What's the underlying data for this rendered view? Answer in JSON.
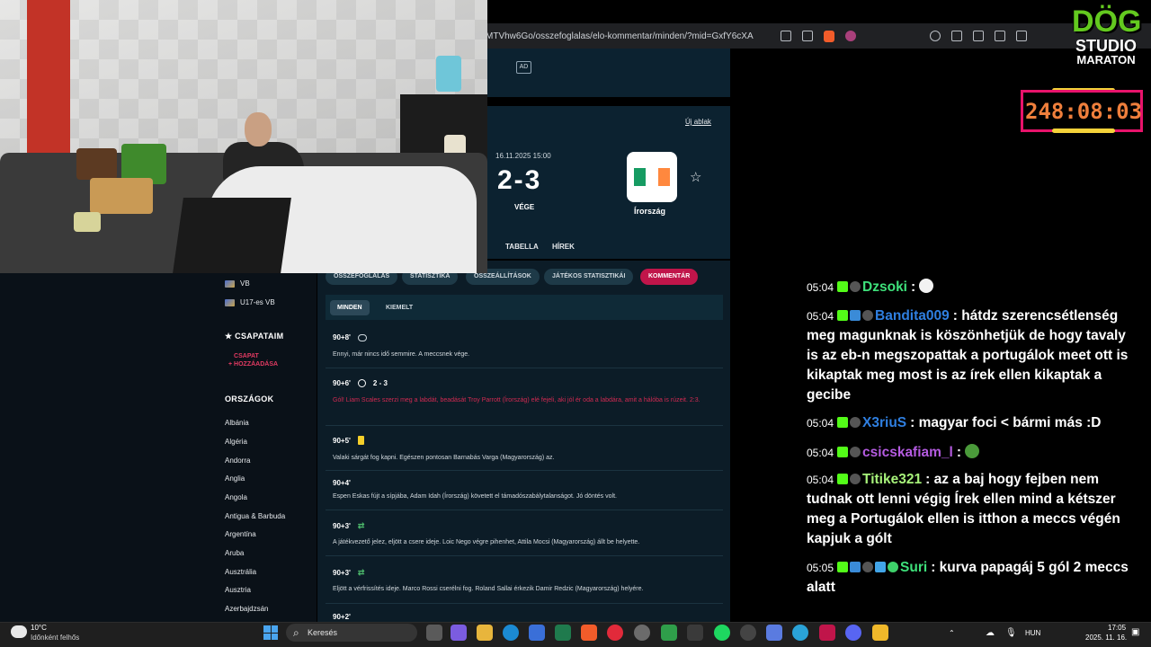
{
  "browser": {
    "url": "MTVhw6Go/osszefoglalas/elo-kommentar/minden/?mid=GxfY6cXA"
  },
  "match": {
    "ad_label": "AD",
    "new_window": "Új ablak",
    "date": "16.11.2025 15:00",
    "score": "2-3",
    "status": "VÉGE",
    "away_team": "Írország",
    "tabs": [
      "I",
      "TABELLA",
      "HÍREK"
    ],
    "subtabs": [
      "ÖSSZEFOGLALÁS",
      "STATISZTIKA",
      "ÖSSZEÁLLÍTÁSOK",
      "JÁTÉKOS STATISZTIKÁI",
      "KOMMENTÁR"
    ],
    "filters": [
      "MINDEN",
      "KIEMELT"
    ]
  },
  "comments": [
    {
      "minute": "90+8'",
      "icon": "whistle-icon",
      "text": "Ennyi, már nincs idő semmire. A meccsnek vége."
    },
    {
      "minute": "90+6'",
      "icon": "ball-icon",
      "score": "2 - 3",
      "text": "Gól! Liam Scales szerzi meg a labdát, beadását Troy Parrott (Írország) elé fejeli, aki jól ér oda a labdára, amit a hálóba is rúzeit. 2:3.",
      "goal": true
    },
    {
      "minute": "90+5'",
      "icon": "yellow-card-icon",
      "text": "Valaki sárgát fog kapni. Egészen pontosan Barnabás Varga (Magyarország) az."
    },
    {
      "minute": "90+4'",
      "icon": "",
      "text": "Espen Eskas fújt a sípjába, Adam Idah (Írország) követett el támadószabálytalanságot. Jó döntés volt."
    },
    {
      "minute": "90+3'",
      "icon": "substitution-icon",
      "text": "A játékvezető jelez, eljött a csere ideje. Loic Nego végre pihenhet, Attila Mocsi (Magyarország) állt be helyette."
    },
    {
      "minute": "90+3'",
      "icon": "substitution-icon",
      "text": "Eljött a vérfrissítés ideje. Marco Rossi cserélni fog. Roland Sallai érkezik Damir Redzic (Magyarország) helyére."
    },
    {
      "minute": "90+2'",
      "icon": "",
      "text": ""
    }
  ],
  "sidebar": {
    "competitions": [
      "VB",
      "U17-es VB"
    ],
    "my_teams": "CSAPATAIM",
    "add_team": "CSAPAT HOZZÁADÁSA",
    "countries_head": "ORSZÁGOK",
    "countries": [
      "Albánia",
      "Algéria",
      "Andorra",
      "Anglia",
      "Angola",
      "Antigua & Barbuda",
      "Argentína",
      "Aruba",
      "Ausztrália",
      "Ausztria",
      "Azerbajdzsán"
    ]
  },
  "stream": {
    "logo_line1": "DÖG",
    "logo_line2": "STUDIO",
    "logo_line3": "MARATON",
    "timer": "248:08:03"
  },
  "chat": [
    {
      "time": "05:04",
      "user": "Dzsoki",
      "color": "#3ee07a",
      "message": ""
    },
    {
      "time": "05:04",
      "user": "Bandita009",
      "color": "#2f7fe0",
      "message": "hátdz szerencsétlenség meg magunknak is köszönhetjük de hogy tavaly is az eb-n megszopattak a portugálok meet ott is kikaptak meg most is az írek ellen kikaptak a gecibe"
    },
    {
      "time": "05:04",
      "user": "X3riuS",
      "color": "#2f7fe0",
      "message": "magyar foci < bármi más :D"
    },
    {
      "time": "05:04",
      "user": "csicskafiam_l",
      "color": "#b45be0",
      "message": ""
    },
    {
      "time": "05:04",
      "user": "Titike321",
      "color": "#a7f27a",
      "message": "az a baj hogy fejben nem tudnak ott lenni végig Írek ellen mind a kétszer meg a Portugálok ellen is itthon a meccs végén kapjuk a gólt"
    },
    {
      "time": "05:05",
      "user": "Suri",
      "color": "#3ee07a",
      "message": "kurva papagáj 5 gól 2 meccs alatt"
    }
  ],
  "taskbar": {
    "temp": "10°C",
    "weather": "Időnként felhős",
    "search": "Keresés",
    "lang": "HUN",
    "time": "17:05",
    "date": "2025. 11. 16."
  },
  "colors": {
    "accent": "#c0154a",
    "panel": "#0c2230",
    "timer_border": "#e8136b",
    "timer_text": "#ef7f3c"
  }
}
